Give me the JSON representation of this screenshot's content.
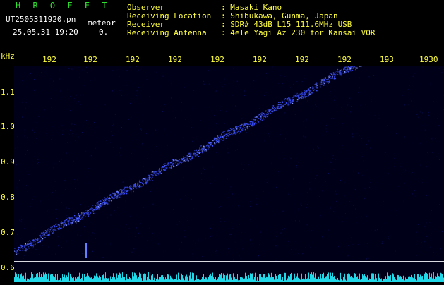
{
  "header": {
    "app_name": "H R O F F T",
    "filename": "UT2505311920.pn",
    "category": "meteor",
    "datetime": "25.05.31 19:20",
    "count": "0.",
    "fields": [
      {
        "label": "Observer",
        "value": ": Masaki Kano"
      },
      {
        "label": "Receiving Location",
        "value": ": Shibukawa, Gunma, Japan"
      },
      {
        "label": "Receiver",
        "value": ": SDR# 43dB L15 111.6MHz USB"
      },
      {
        "label": "Receiving Antenna",
        "value": ": 4ele Yagi Az 230 for Kansai VOR"
      }
    ]
  },
  "axes": {
    "y_unit": "kHz",
    "y_ticks": [
      "1.1",
      "1.0",
      "0.9",
      "0.8",
      "0.7",
      "0.6"
    ],
    "x_ticks": [
      "192",
      "192",
      "192",
      "192",
      "192",
      "192",
      "192",
      "192",
      "193",
      "1930"
    ]
  },
  "spectrogram": {
    "trace_color": "#3a50ff",
    "background": "#000018",
    "trace_start_khz": 0.65,
    "trace_end_khz": 1.2
  }
}
